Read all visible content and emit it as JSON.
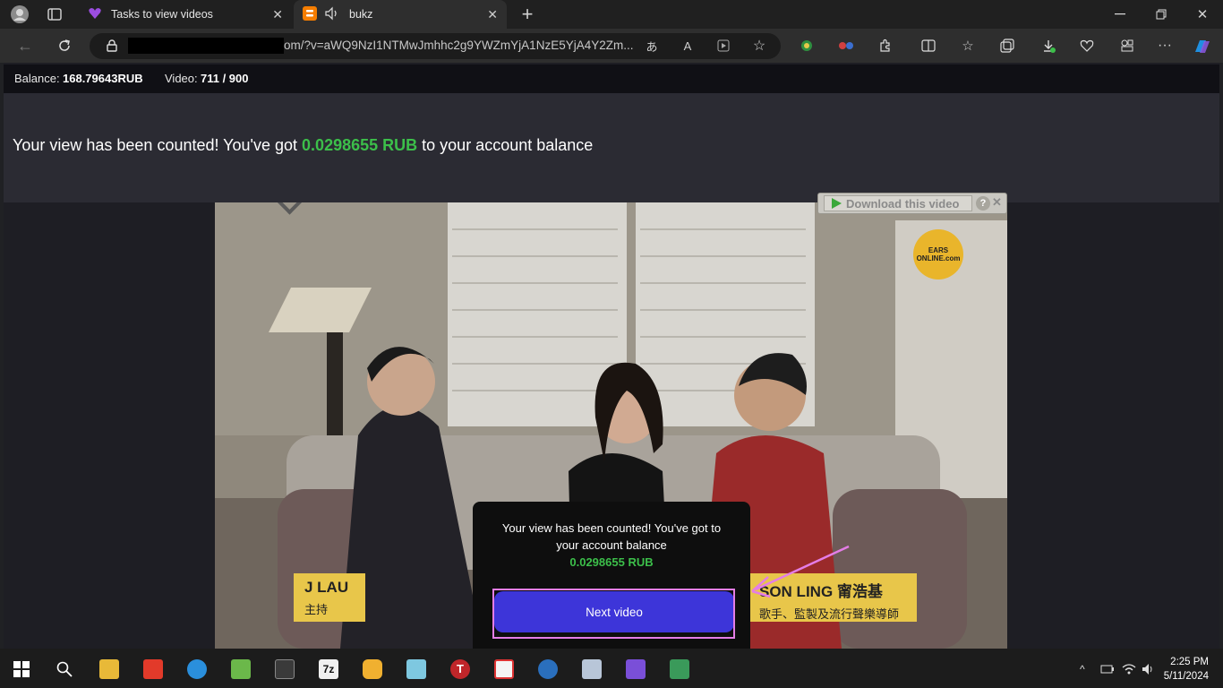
{
  "browser": {
    "tabs": [
      {
        "title": "Tasks to view videos",
        "active": false
      },
      {
        "title": "bukz",
        "active": true
      }
    ],
    "url": "om/?v=aWQ9NzI1NTMwJmhhc2g9YWZmYjA1NzE5YjA4Y2Zm..."
  },
  "topbar": {
    "balance_label": "Balance:",
    "balance_value": "168.79643RUB",
    "video_label": "Video:",
    "video_value": "711 / 900"
  },
  "message": {
    "prefix": "Your view has been counted! You've got",
    "amount": "0.0298655 RUB",
    "suffix": "to your account balance"
  },
  "video": {
    "download_label": "Download this video",
    "help_label": "?",
    "caption_left_name": "J LAU",
    "caption_left_role": "主持",
    "caption_right_name": "SON LING 甯浩基",
    "caption_right_role": "歌手、監製及流行聲樂導師",
    "logo_text": "EARS ONLINE.com"
  },
  "modal": {
    "text": "Your view has been counted! You've got to your account balance",
    "amount": "0.0298655 RUB",
    "button_label": "Next video"
  },
  "taskbar": {
    "time": "2:25 PM",
    "date": "5/11/2024"
  },
  "colors": {
    "accent_green": "#3cbf4a",
    "button_blue": "#3d35d9",
    "highlight": "#e47de6"
  }
}
